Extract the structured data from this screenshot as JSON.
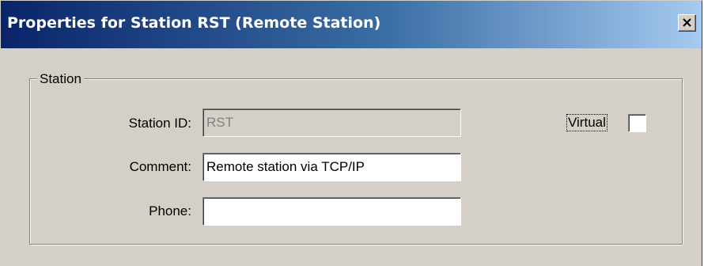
{
  "window": {
    "title": "Properties for Station RST (Remote Station)"
  },
  "icons": {
    "close": "close-icon"
  },
  "colors": {
    "titlebar_start": "#0a246a",
    "titlebar_end": "#a6caf0",
    "dialog_background": "#d4d0c8",
    "disabled_text": "#808080"
  },
  "station_group": {
    "legend": "Station",
    "station_id": {
      "label": "Station ID:",
      "value": "RST",
      "enabled": false
    },
    "comment": {
      "label": "Comment:",
      "value": "Remote station via TCP/IP"
    },
    "phone": {
      "label": "Phone:",
      "value": ""
    },
    "virtual": {
      "label": "Virtual",
      "checked": false
    }
  }
}
